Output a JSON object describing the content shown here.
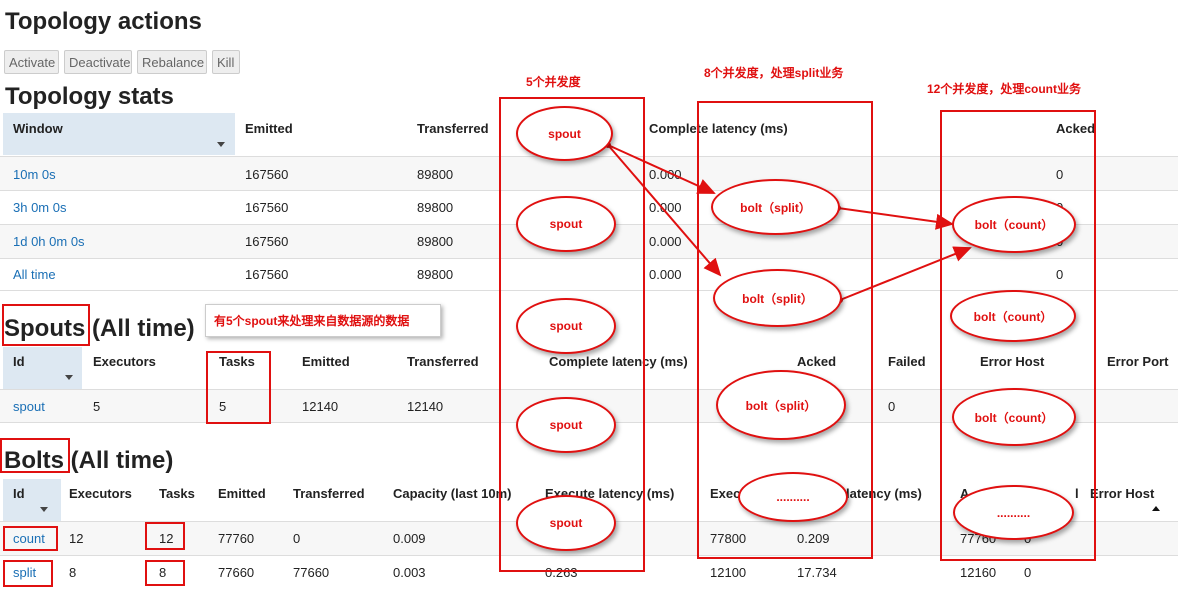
{
  "topology_actions": {
    "title": "Topology actions",
    "buttons": [
      "Activate",
      "Deactivate",
      "Rebalance",
      "Kill"
    ]
  },
  "topology_stats": {
    "title": "Topology stats",
    "headers": [
      "Window",
      "Emitted",
      "Transferred",
      "Complete latency (ms)",
      "Acked"
    ],
    "rows": [
      [
        "10m 0s",
        "167560",
        "89800",
        "0.000",
        "0"
      ],
      [
        "3h 0m 0s",
        "167560",
        "89800",
        "0.000",
        "0"
      ],
      [
        "1d 0h 0m 0s",
        "167560",
        "89800",
        "0.000",
        "0"
      ],
      [
        "All time",
        "167560",
        "89800",
        "0.000",
        "0"
      ]
    ]
  },
  "spouts": {
    "title_main": "Spouts",
    "title_suffix": "(All time)",
    "headers": [
      "Id",
      "Executors",
      "Tasks",
      "Emitted",
      "Transferred",
      "Complete latency (ms)",
      "Acked",
      "Failed",
      "Error Host",
      "Error Port"
    ],
    "row": [
      "spout",
      "5",
      "5",
      "12140",
      "12140",
      "0"
    ]
  },
  "bolts": {
    "title_main": "Bolts",
    "title_suffix": "(All time)",
    "headers": [
      "Id",
      "Executors",
      "Tasks",
      "Emitted",
      "Transferred",
      "Capacity (last 10m)",
      "Execute latency (ms)",
      "Exec",
      "latency (ms)",
      "A",
      "l",
      "Error Host"
    ],
    "rows": [
      {
        "id": "count",
        "executors": "12",
        "tasks": "12",
        "emitted": "77760",
        "transferred": "0",
        "capacity": "0.009",
        "executed": "77800",
        "proc_latency": "0.209",
        "acked": "77760",
        "failed": "0"
      },
      {
        "id": "split",
        "executors": "8",
        "tasks": "8",
        "emitted": "77660",
        "transferred": "77660",
        "capacity": "0.003",
        "exec_latency": "0.263",
        "executed": "12100",
        "proc_latency": "17.734",
        "acked": "12160",
        "failed": "0"
      }
    ]
  },
  "annotations": {
    "spout_parallelism": "5个并发度",
    "split_parallelism": "8个并发度，处理split业务",
    "count_parallelism": "12个并发度，处理count业务",
    "spout_note": "有5个spout来处理来自数据源的数据",
    "spout_label": "spout",
    "split_label": "bolt（split）",
    "count_label": "bolt（count）",
    "ellipsis": "..........",
    "accent": "#e01010"
  }
}
